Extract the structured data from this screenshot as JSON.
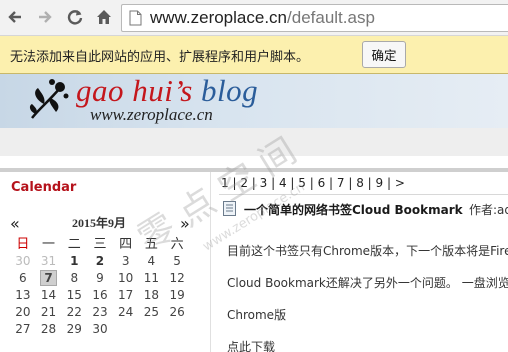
{
  "browser": {
    "url_host": "www.zeroplace.cn",
    "url_path": "/default.asp"
  },
  "infobar": {
    "message": "无法添加来自此网站的应用、扩展程序和用户脚本。",
    "button_label": "确定"
  },
  "banner": {
    "title_part1": "gao hui’s",
    "title_part2": "blog",
    "url": "www.zeroplace.cn"
  },
  "calendar": {
    "heading": "Calendar",
    "prev": "«",
    "next": "»",
    "month_label": "2015年9月",
    "weekdays": [
      "日",
      "一",
      "二",
      "三",
      "四",
      "五",
      "六"
    ],
    "weeks": [
      [
        "30",
        "31",
        "1",
        "2",
        "3",
        "4",
        "5"
      ],
      [
        "6",
        "7",
        "8",
        "9",
        "10",
        "11",
        "12"
      ],
      [
        "13",
        "14",
        "15",
        "16",
        "17",
        "18",
        "19"
      ],
      [
        "20",
        "21",
        "22",
        "23",
        "24",
        "25",
        "26"
      ],
      [
        "27",
        "28",
        "29",
        "30",
        "",
        "",
        ""
      ]
    ]
  },
  "main": {
    "pager": [
      "1",
      "2",
      "3",
      "4",
      "5",
      "6",
      "7",
      "8",
      "9",
      ">"
    ],
    "post_title": "一个简单的网络书签Cloud Bookmark",
    "post_author": "作者:ad",
    "paragraphs": [
      "目前这个书签只有Chrome版本，下一个版本将是Firef",
      "Cloud Bookmark还解决了另外一个问题。 一盘浏览器",
      "Chrome版",
      "点此下载"
    ]
  },
  "watermark": {
    "characters": "零 点 空 间",
    "url": "www.zeroplace.cn"
  },
  "colors": {
    "accent_red": "#b5121b",
    "banner_blue": "#2b5d9a",
    "infobar_bg": "#fcf0ae"
  }
}
